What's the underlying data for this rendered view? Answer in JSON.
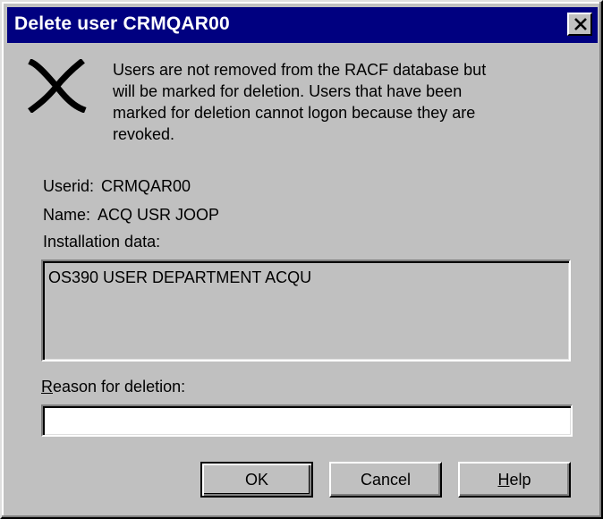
{
  "dialog": {
    "title": "Delete user CRMQAR00",
    "icon": "delete-x-icon",
    "message": "Users are not removed from the RACF database but\nwill be marked for deletion. Users that have been\nmarked for deletion cannot logon because they are\nrevoked.",
    "close_icon": "close-icon"
  },
  "fields": {
    "userid_label": "Userid:",
    "userid_value": "CRMQAR00",
    "name_label": "Name:",
    "name_value": "ACQ USR JOOP",
    "installation_label": "Installation data:",
    "installation_value": "OS390 USER DEPARTMENT ACQU"
  },
  "reason": {
    "label_mnemonic": "R",
    "label_rest": "eason for deletion:",
    "value": ""
  },
  "buttons": {
    "ok": "OK",
    "cancel": "Cancel",
    "help_mnemonic": "H",
    "help_rest": "elp"
  }
}
